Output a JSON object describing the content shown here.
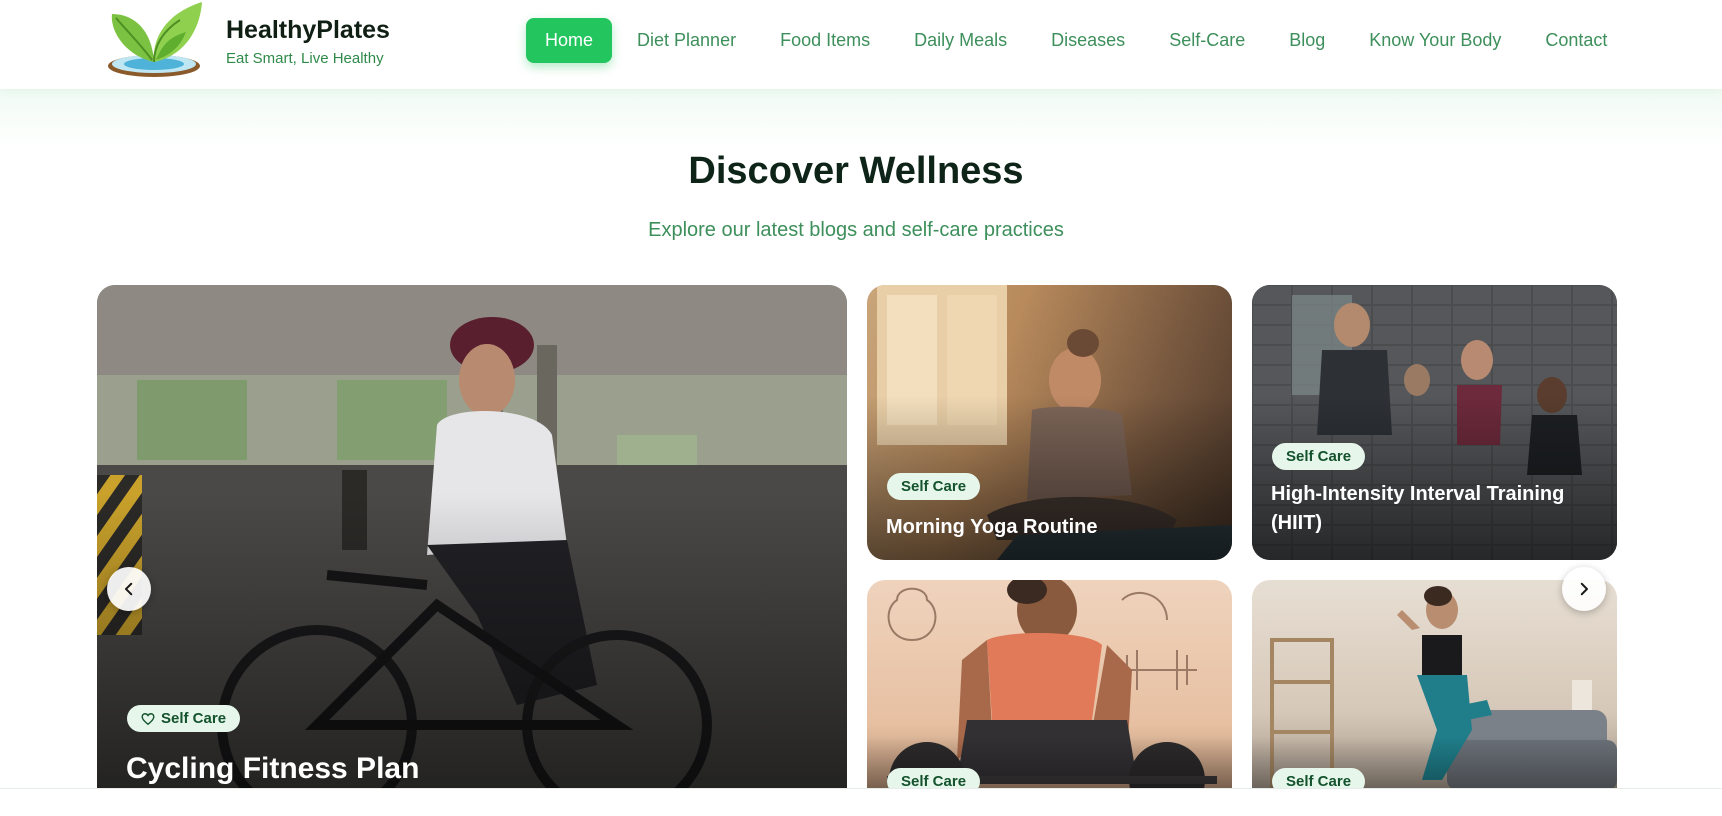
{
  "brand": {
    "name": "HealthyPlates",
    "tagline": "Eat Smart, Live Healthy",
    "logo_icon": "leaf-bowl-logo"
  },
  "nav": {
    "items": [
      {
        "label": "Home",
        "active": true
      },
      {
        "label": "Diet Planner"
      },
      {
        "label": "Food Items"
      },
      {
        "label": "Daily Meals"
      },
      {
        "label": "Diseases"
      },
      {
        "label": "Self-Care"
      },
      {
        "label": "Blog"
      },
      {
        "label": "Know Your Body"
      },
      {
        "label": "Contact"
      }
    ]
  },
  "section": {
    "title": "Discover Wellness",
    "subtitle": "Explore our latest blogs and self-care practices"
  },
  "cards": {
    "featured": {
      "badge": "Self Care",
      "badge_icon": "heart-icon",
      "title": "Cycling Fitness Plan"
    },
    "yoga": {
      "badge": "Self Care",
      "title": "Morning Yoga Routine"
    },
    "hiit": {
      "badge": "Self Care",
      "title": "High-Intensity Interval Training (HIIT)"
    },
    "lifting": {
      "badge": "Self Care"
    },
    "home_workout": {
      "badge": "Self Care"
    }
  },
  "controls": {
    "prev_icon": "chevron-left-icon",
    "next_icon": "chevron-right-icon"
  },
  "colors": {
    "accent": "#22c55e",
    "nav_text": "#3d8f5b",
    "badge_bg": "#e6f6ea",
    "badge_text": "#14532d"
  }
}
